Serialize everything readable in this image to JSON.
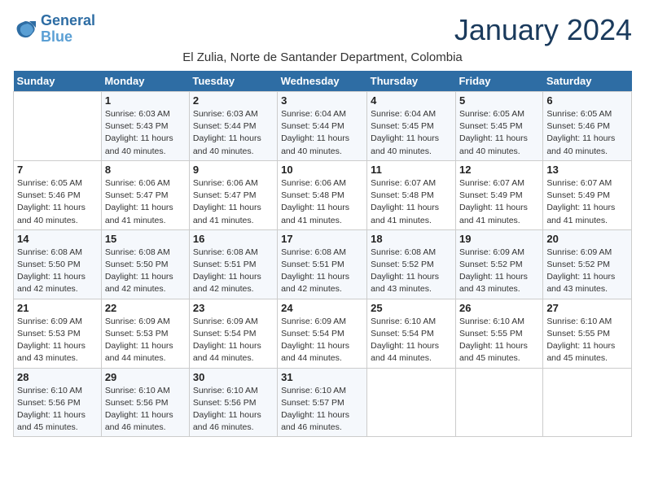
{
  "header": {
    "logo_line1": "General",
    "logo_line2": "Blue",
    "month_year": "January 2024",
    "location": "El Zulia, Norte de Santander Department, Colombia"
  },
  "days_of_week": [
    "Sunday",
    "Monday",
    "Tuesday",
    "Wednesday",
    "Thursday",
    "Friday",
    "Saturday"
  ],
  "weeks": [
    [
      {
        "num": "",
        "sunrise": "",
        "sunset": "",
        "daylight": ""
      },
      {
        "num": "1",
        "sunrise": "Sunrise: 6:03 AM",
        "sunset": "Sunset: 5:43 PM",
        "daylight": "Daylight: 11 hours and 40 minutes."
      },
      {
        "num": "2",
        "sunrise": "Sunrise: 6:03 AM",
        "sunset": "Sunset: 5:44 PM",
        "daylight": "Daylight: 11 hours and 40 minutes."
      },
      {
        "num": "3",
        "sunrise": "Sunrise: 6:04 AM",
        "sunset": "Sunset: 5:44 PM",
        "daylight": "Daylight: 11 hours and 40 minutes."
      },
      {
        "num": "4",
        "sunrise": "Sunrise: 6:04 AM",
        "sunset": "Sunset: 5:45 PM",
        "daylight": "Daylight: 11 hours and 40 minutes."
      },
      {
        "num": "5",
        "sunrise": "Sunrise: 6:05 AM",
        "sunset": "Sunset: 5:45 PM",
        "daylight": "Daylight: 11 hours and 40 minutes."
      },
      {
        "num": "6",
        "sunrise": "Sunrise: 6:05 AM",
        "sunset": "Sunset: 5:46 PM",
        "daylight": "Daylight: 11 hours and 40 minutes."
      }
    ],
    [
      {
        "num": "7",
        "sunrise": "Sunrise: 6:05 AM",
        "sunset": "Sunset: 5:46 PM",
        "daylight": "Daylight: 11 hours and 40 minutes."
      },
      {
        "num": "8",
        "sunrise": "Sunrise: 6:06 AM",
        "sunset": "Sunset: 5:47 PM",
        "daylight": "Daylight: 11 hours and 41 minutes."
      },
      {
        "num": "9",
        "sunrise": "Sunrise: 6:06 AM",
        "sunset": "Sunset: 5:47 PM",
        "daylight": "Daylight: 11 hours and 41 minutes."
      },
      {
        "num": "10",
        "sunrise": "Sunrise: 6:06 AM",
        "sunset": "Sunset: 5:48 PM",
        "daylight": "Daylight: 11 hours and 41 minutes."
      },
      {
        "num": "11",
        "sunrise": "Sunrise: 6:07 AM",
        "sunset": "Sunset: 5:48 PM",
        "daylight": "Daylight: 11 hours and 41 minutes."
      },
      {
        "num": "12",
        "sunrise": "Sunrise: 6:07 AM",
        "sunset": "Sunset: 5:49 PM",
        "daylight": "Daylight: 11 hours and 41 minutes."
      },
      {
        "num": "13",
        "sunrise": "Sunrise: 6:07 AM",
        "sunset": "Sunset: 5:49 PM",
        "daylight": "Daylight: 11 hours and 41 minutes."
      }
    ],
    [
      {
        "num": "14",
        "sunrise": "Sunrise: 6:08 AM",
        "sunset": "Sunset: 5:50 PM",
        "daylight": "Daylight: 11 hours and 42 minutes."
      },
      {
        "num": "15",
        "sunrise": "Sunrise: 6:08 AM",
        "sunset": "Sunset: 5:50 PM",
        "daylight": "Daylight: 11 hours and 42 minutes."
      },
      {
        "num": "16",
        "sunrise": "Sunrise: 6:08 AM",
        "sunset": "Sunset: 5:51 PM",
        "daylight": "Daylight: 11 hours and 42 minutes."
      },
      {
        "num": "17",
        "sunrise": "Sunrise: 6:08 AM",
        "sunset": "Sunset: 5:51 PM",
        "daylight": "Daylight: 11 hours and 42 minutes."
      },
      {
        "num": "18",
        "sunrise": "Sunrise: 6:08 AM",
        "sunset": "Sunset: 5:52 PM",
        "daylight": "Daylight: 11 hours and 43 minutes."
      },
      {
        "num": "19",
        "sunrise": "Sunrise: 6:09 AM",
        "sunset": "Sunset: 5:52 PM",
        "daylight": "Daylight: 11 hours and 43 minutes."
      },
      {
        "num": "20",
        "sunrise": "Sunrise: 6:09 AM",
        "sunset": "Sunset: 5:52 PM",
        "daylight": "Daylight: 11 hours and 43 minutes."
      }
    ],
    [
      {
        "num": "21",
        "sunrise": "Sunrise: 6:09 AM",
        "sunset": "Sunset: 5:53 PM",
        "daylight": "Daylight: 11 hours and 43 minutes."
      },
      {
        "num": "22",
        "sunrise": "Sunrise: 6:09 AM",
        "sunset": "Sunset: 5:53 PM",
        "daylight": "Daylight: 11 hours and 44 minutes."
      },
      {
        "num": "23",
        "sunrise": "Sunrise: 6:09 AM",
        "sunset": "Sunset: 5:54 PM",
        "daylight": "Daylight: 11 hours and 44 minutes."
      },
      {
        "num": "24",
        "sunrise": "Sunrise: 6:09 AM",
        "sunset": "Sunset: 5:54 PM",
        "daylight": "Daylight: 11 hours and 44 minutes."
      },
      {
        "num": "25",
        "sunrise": "Sunrise: 6:10 AM",
        "sunset": "Sunset: 5:54 PM",
        "daylight": "Daylight: 11 hours and 44 minutes."
      },
      {
        "num": "26",
        "sunrise": "Sunrise: 6:10 AM",
        "sunset": "Sunset: 5:55 PM",
        "daylight": "Daylight: 11 hours and 45 minutes."
      },
      {
        "num": "27",
        "sunrise": "Sunrise: 6:10 AM",
        "sunset": "Sunset: 5:55 PM",
        "daylight": "Daylight: 11 hours and 45 minutes."
      }
    ],
    [
      {
        "num": "28",
        "sunrise": "Sunrise: 6:10 AM",
        "sunset": "Sunset: 5:56 PM",
        "daylight": "Daylight: 11 hours and 45 minutes."
      },
      {
        "num": "29",
        "sunrise": "Sunrise: 6:10 AM",
        "sunset": "Sunset: 5:56 PM",
        "daylight": "Daylight: 11 hours and 46 minutes."
      },
      {
        "num": "30",
        "sunrise": "Sunrise: 6:10 AM",
        "sunset": "Sunset: 5:56 PM",
        "daylight": "Daylight: 11 hours and 46 minutes."
      },
      {
        "num": "31",
        "sunrise": "Sunrise: 6:10 AM",
        "sunset": "Sunset: 5:57 PM",
        "daylight": "Daylight: 11 hours and 46 minutes."
      },
      {
        "num": "",
        "sunrise": "",
        "sunset": "",
        "daylight": ""
      },
      {
        "num": "",
        "sunrise": "",
        "sunset": "",
        "daylight": ""
      },
      {
        "num": "",
        "sunrise": "",
        "sunset": "",
        "daylight": ""
      }
    ]
  ]
}
